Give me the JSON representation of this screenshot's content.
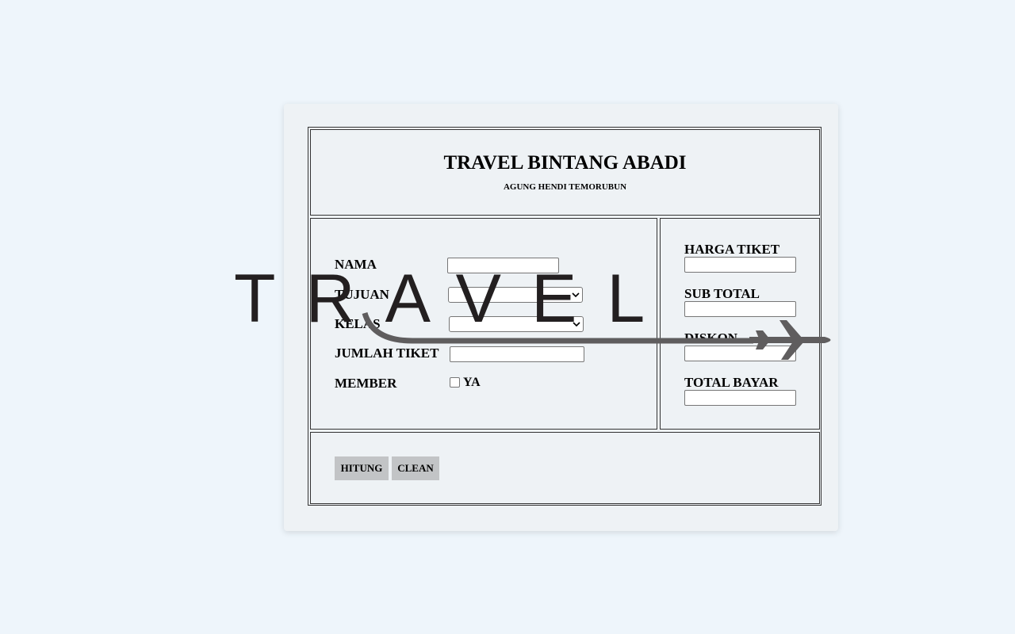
{
  "header": {
    "title": "TRAVEL BINTANG ABADI",
    "subtitle": "AGUNG HENDI TEMORUBUN"
  },
  "form": {
    "nama_label": "NAMA",
    "nama_value": "",
    "tujuan_label": "TUJUAN",
    "tujuan_value": "",
    "kelas_label": "KELAS",
    "kelas_value": "",
    "jumlah_tiket_label": "JUMLAH TIKET",
    "jumlah_tiket_value": "",
    "member_label": "MEMBER",
    "member_option": "YA",
    "member_checked": false
  },
  "summary": {
    "harga_tiket_label": "HARGA TIKET",
    "harga_tiket_value": "",
    "sub_total_label": "SUB TOTAL",
    "sub_total_value": "",
    "diskon_label": "DISKON",
    "diskon_value": "",
    "total_bayar_label": "TOTAL BAYAR",
    "total_bayar_value": ""
  },
  "actions": {
    "hitung_label": "HITUNG",
    "clean_label": "CLEAN"
  },
  "logo": {
    "text": "TRAVEL",
    "icon": "airplane-icon"
  },
  "colors": {
    "background": "#eef5fb",
    "card": "#eef2f5",
    "button": "#c2c4c6",
    "logo_dark": "#231f20",
    "logo_gray": "#5f5d5e"
  }
}
